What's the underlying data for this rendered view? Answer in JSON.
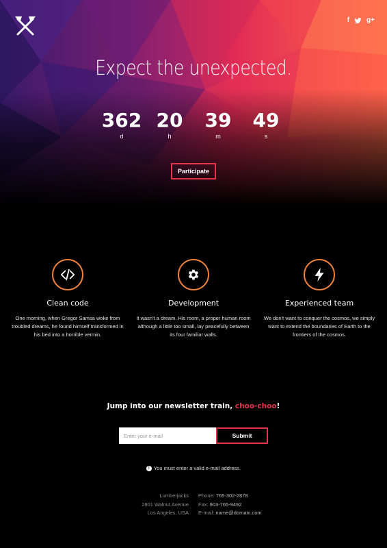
{
  "hero": {
    "tagline": "Expect the unexpected.",
    "participate_label": "Participate",
    "social_icons": [
      "facebook-icon",
      "twitter-icon",
      "google-plus-icon"
    ],
    "social": {
      "facebook": "f",
      "google_plus": "g+"
    }
  },
  "countdown": [
    {
      "value": "362",
      "unit": "d"
    },
    {
      "value": "20",
      "unit": "h"
    },
    {
      "value": "39",
      "unit": "m"
    },
    {
      "value": "49",
      "unit": "s"
    }
  ],
  "features": [
    {
      "icon": "code-icon",
      "title": "Clean code",
      "text": "One morning, when Gregor Samsa woke from troubled dreams, he found himself transformed in his bed into a horrible vermin."
    },
    {
      "icon": "gear-icon",
      "title": "Development",
      "text": "It wasn't a dream. His room, a proper human room although a little too small, lay peacefully between its four familiar walls."
    },
    {
      "icon": "lightning-icon",
      "title": "Experienced team",
      "text": "We don't want to conquer the cosmos, we simply want to extend the boundaries of Earth to the frontiers of the cosmos."
    }
  ],
  "newsletter": {
    "title": "Jump into our newsletter train, ",
    "title_accent": "choo-choo",
    "title_end": "!",
    "placeholder": "Enter your e-mail",
    "submit_label": "Submit",
    "error": "You must enter a valid e-mail address."
  },
  "footer": {
    "address": [
      "Lumberjacks",
      "2801 Walnut Avenue",
      "Los Angeles, USA"
    ],
    "phone_label": "Phone: ",
    "phone": "765-302-2878",
    "fax_label": "Fax: ",
    "fax": "903-765-9492",
    "email_label": "E-mail: ",
    "email": "name@domain.com"
  },
  "colors": {
    "accent": "#e8344a",
    "icon_ring": "#f0813a",
    "background": "#000000"
  }
}
